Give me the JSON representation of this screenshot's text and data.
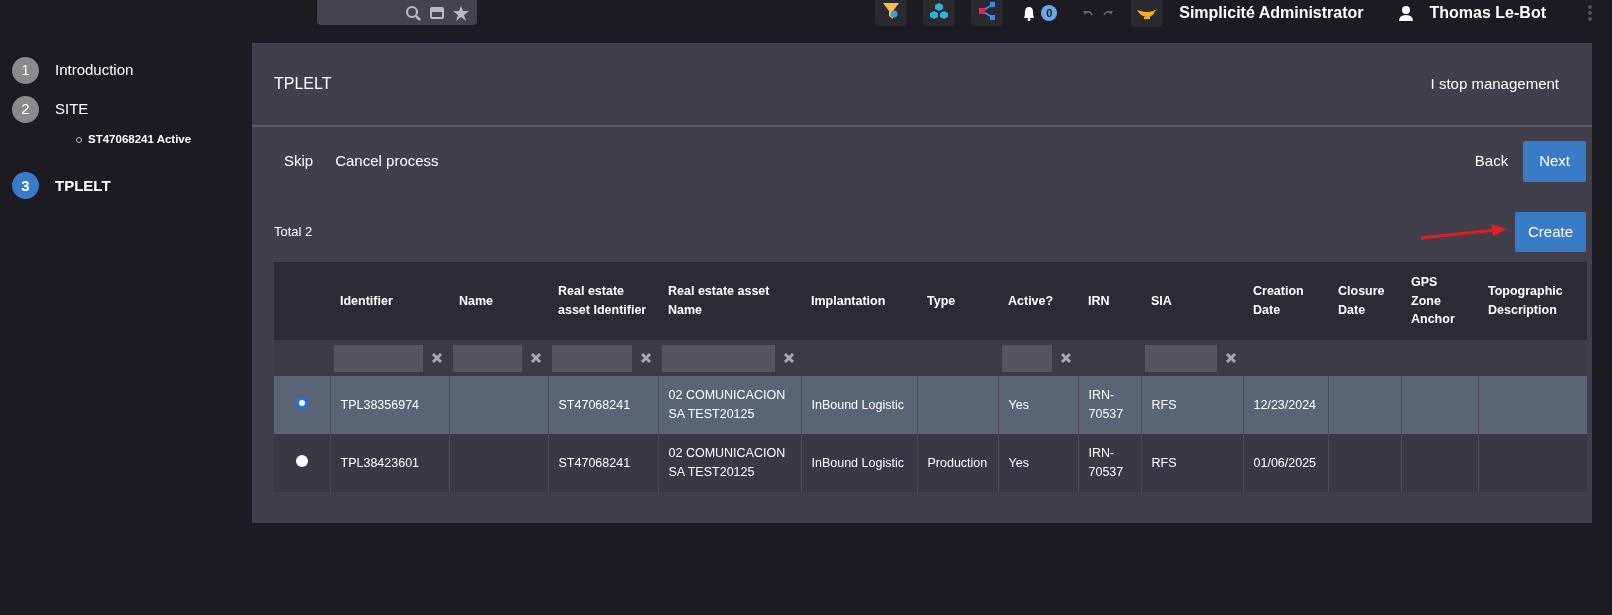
{
  "topbar": {
    "notification_count": "0",
    "app_name": "Simplicité Administrator",
    "user_name": "Thomas Le-Bot"
  },
  "steps": [
    {
      "number": "1",
      "label": "Introduction",
      "selected": false
    },
    {
      "number": "2",
      "label": "SITE",
      "selected": false,
      "children": [
        {
          "label": "ST47068241 Active"
        }
      ]
    },
    {
      "number": "3",
      "label": "TPLELT",
      "selected": true
    }
  ],
  "panel": {
    "title": "TPLELT",
    "header_action": "I stop management"
  },
  "toolbar": {
    "left": [
      "Skip",
      "Cancel process"
    ],
    "back": "Back",
    "next": "Next"
  },
  "list": {
    "total": "Total 2",
    "create": "Create"
  },
  "table": {
    "columns": [
      {
        "label": "Identifier",
        "filter": true
      },
      {
        "label": "Name",
        "filter": true
      },
      {
        "label": "Real estate asset Identifier",
        "filter": true
      },
      {
        "label": "Real estate asset Name",
        "filter": true
      },
      {
        "label": "Implantation",
        "filter": false
      },
      {
        "label": "Type",
        "filter": false
      },
      {
        "label": "Active?",
        "filter": true
      },
      {
        "label": "IRN",
        "filter": false
      },
      {
        "label": "SIA",
        "filter": true
      },
      {
        "label": "Creation Date",
        "filter": false
      },
      {
        "label": "Closure Date",
        "filter": false
      },
      {
        "label": "GPS Zone Anchor",
        "filter": false
      },
      {
        "label": "Topographic Description",
        "filter": false
      }
    ],
    "rows": [
      {
        "selected": true,
        "cells": [
          "TPL38356974",
          "",
          "ST47068241",
          "02 COMUNICACION SA TEST20125",
          "InBound Logistic",
          "",
          "Yes",
          "IRN-70537",
          "RFS",
          "12/23/2024",
          "",
          "",
          ""
        ]
      },
      {
        "selected": false,
        "cells": [
          "TPL38423601",
          "",
          "ST47068241",
          "02 COMUNICACION SA TEST20125",
          "InBound Logistic",
          "Production",
          "Yes",
          "IRN-70537",
          "RFS",
          "01/06/2025",
          "",
          "",
          ""
        ]
      }
    ]
  }
}
